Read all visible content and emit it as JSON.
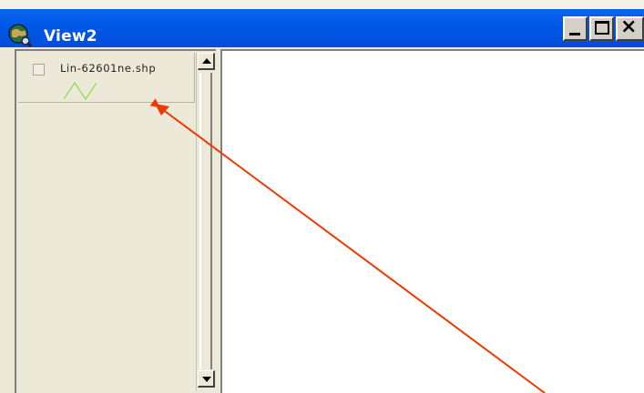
{
  "window": {
    "title": "View2",
    "controls": {
      "minimize_icon": "minimize-icon",
      "maximize_icon": "maximize-icon",
      "close_glyph": "×"
    }
  },
  "toc": {
    "themes": [
      {
        "label": "Lin-62601ne.shp",
        "visible": false,
        "symbol": "line-symbol",
        "symbol_color": "#99dd55"
      }
    ]
  },
  "annotation": {
    "arrow_color": "#ee3a00"
  },
  "colors": {
    "titlebar": "#0057e7",
    "panel_bg": "#ece9d8",
    "canvas_bg": "#ffffff"
  }
}
